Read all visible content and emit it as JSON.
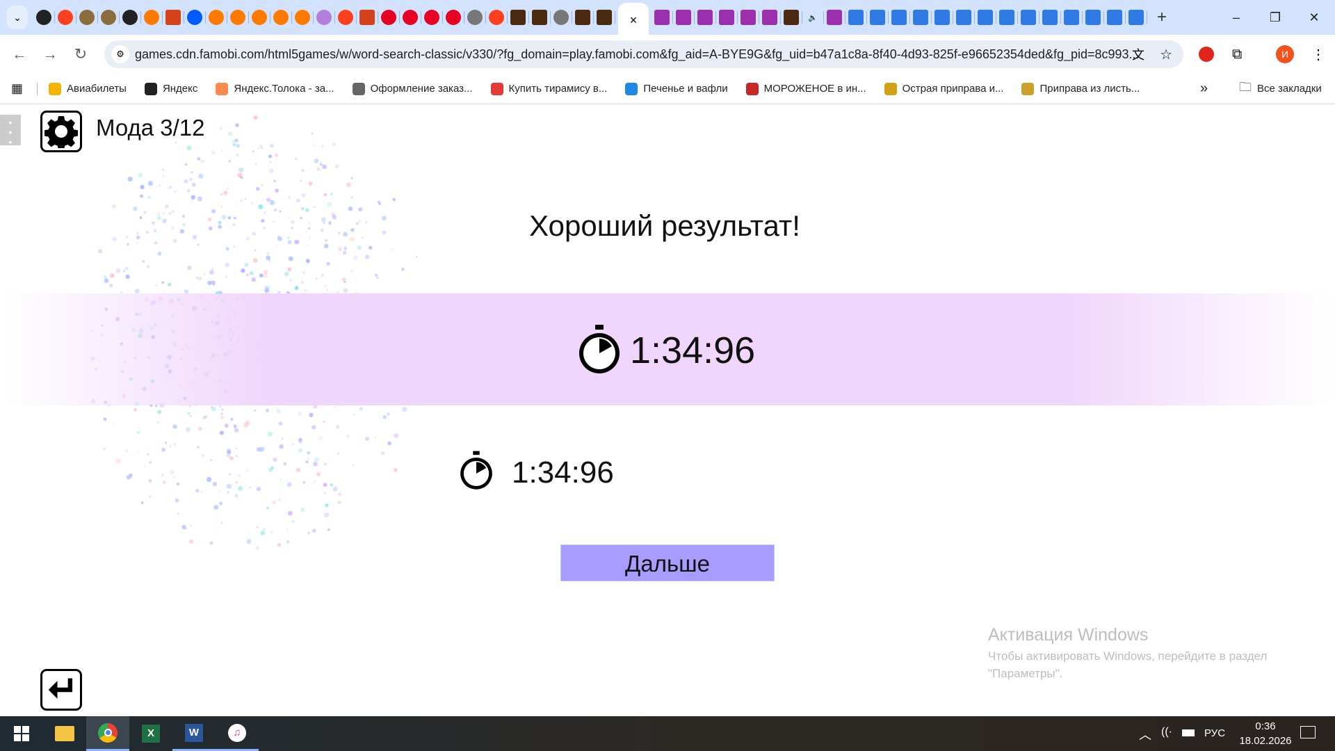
{
  "browser": {
    "tabs": {
      "favicons": [
        "yandex-star",
        "yandex",
        "cauldron",
        "cauldron",
        "yandex-star",
        "market",
        "warrior",
        "ozon",
        "market",
        "market",
        "market",
        "market",
        "market",
        "search",
        "yandex",
        "warrior",
        "pinterest",
        "pinterest",
        "pinterest",
        "pinterest",
        "globe",
        "yandex",
        "game-badge",
        "game-badge",
        "globe",
        "game-badge",
        "game-badge"
      ],
      "active_close": "×",
      "after_favicons": [
        "game",
        "game",
        "game",
        "game",
        "game",
        "game",
        "game-badge",
        "speaker",
        "game",
        "blue",
        "blue",
        "blue",
        "blue",
        "blue",
        "blue",
        "blue",
        "blue",
        "blue",
        "blue",
        "blue",
        "blue",
        "blue",
        "blue"
      ],
      "new_tab": "+"
    },
    "window": {
      "minimize": "–",
      "restore": "❐",
      "close": "✕"
    },
    "url": "games.cdn.famobi.com/html5games/w/word-search-classic/v330/?fg_domain=play.famobi.com&fg_aid=A-BYE9G&fg_uid=b47a1c8a-8f40-4d93-825f-e96652354ded&fg_pid=8c993...",
    "profile_initial": "И",
    "bookmarks": [
      {
        "label": "Авиабилеты",
        "color": "#f5b400"
      },
      {
        "label": "Яндекс",
        "color": "#222"
      },
      {
        "label": "Яндекс.Толока - за...",
        "color": "#ff8a50"
      },
      {
        "label": "Оформление заказ...",
        "color": "#666"
      },
      {
        "label": "Купить тирамису в...",
        "color": "#e53935"
      },
      {
        "label": "Печенье и вафли",
        "color": "#1e88e5"
      },
      {
        "label": "МОРОЖЕНОЕ в ин...",
        "color": "#c62828"
      },
      {
        "label": "Острая приправа и...",
        "color": "#d4a017"
      },
      {
        "label": "Приправа из листь...",
        "color": "#c9a227"
      }
    ],
    "more_bookmarks": "»",
    "all_bookmarks": "Все закладки"
  },
  "game": {
    "level_title": "Мода 3/12",
    "heading": "Хороший результат!",
    "current_time": "1:34:96",
    "best_time": "1:34:96",
    "next_button": "Дальше",
    "colors": {
      "band": "#f0d6fc",
      "button": "#a99cff"
    }
  },
  "watermark": {
    "title": "Активация Windows",
    "line1": "Чтобы активировать Windows, перейдите в раздел",
    "line2": "\"Параметры\"."
  },
  "taskbar": {
    "lang": "РУС",
    "time": "0:36",
    "date": "18.02.2026"
  }
}
